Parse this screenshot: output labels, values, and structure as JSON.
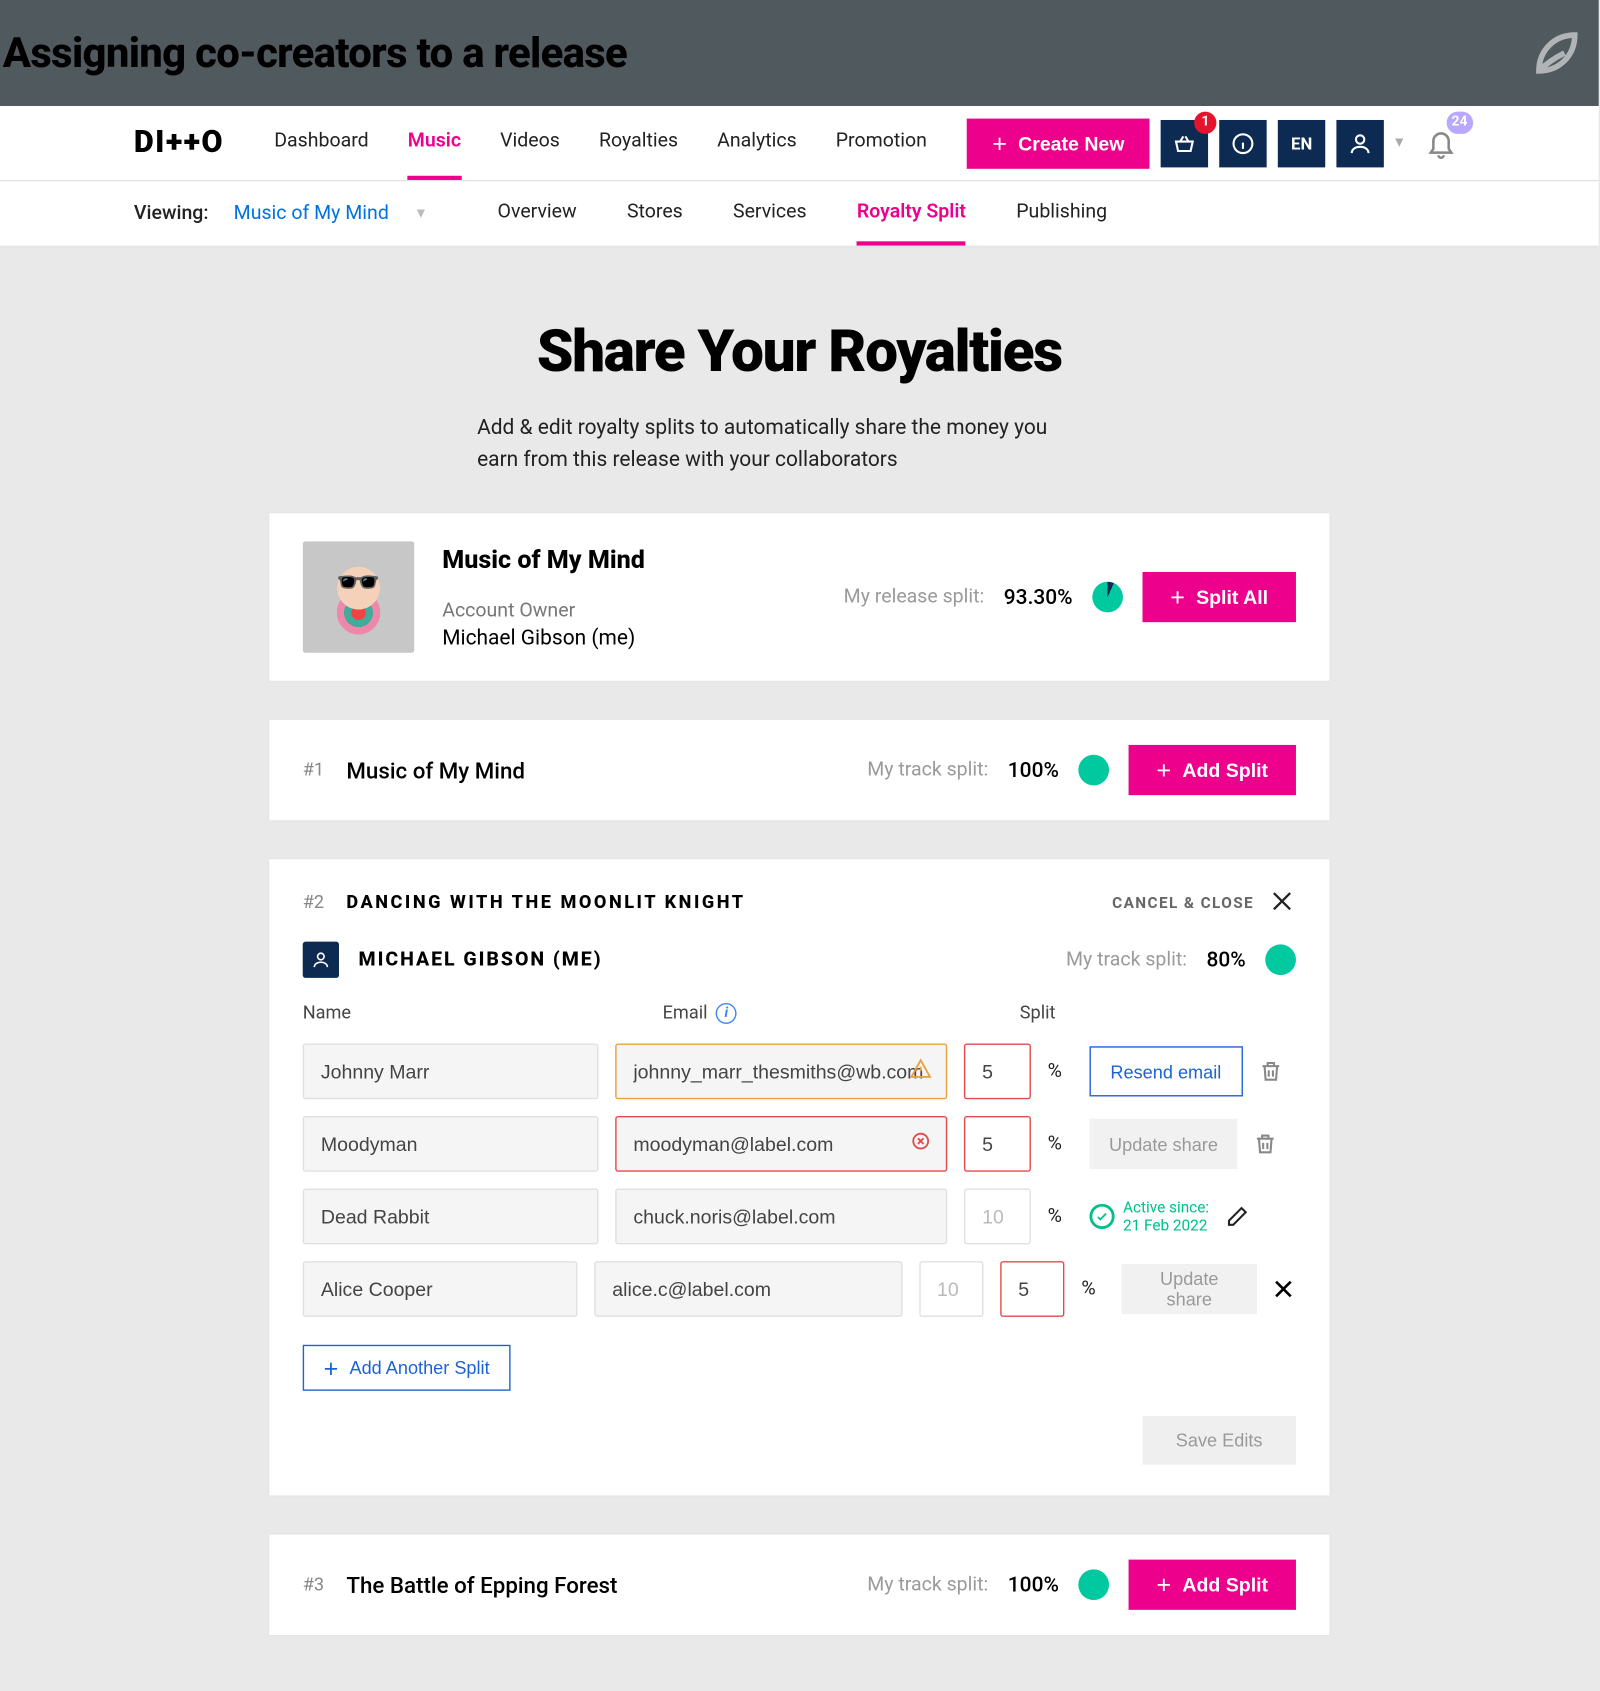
{
  "page_header": {
    "title": "Assigning co-creators to a release"
  },
  "logo": "DI++O",
  "nav": {
    "items": [
      "Dashboard",
      "Music",
      "Videos",
      "Royalties",
      "Analytics",
      "Promotion"
    ],
    "active": "Music",
    "create_label": "Create New",
    "cart_badge": "1",
    "lang": "EN",
    "bell_badge": "24"
  },
  "subnav": {
    "viewing_label": "Viewing:",
    "release": "Music of My Mind",
    "items": [
      "Overview",
      "Stores",
      "Services",
      "Royalty Split",
      "Publishing"
    ],
    "active": "Royalty Split"
  },
  "hero": {
    "title": "Share Your Royalties",
    "sub": "Add & edit royalty splits to automatically share the money you earn from this release with your collaborators"
  },
  "release_card": {
    "title": "Music of My Mind",
    "role": "Account Owner",
    "owner": "Michael Gibson (me)",
    "split_label": "My release split:",
    "split_pct": "93.30%",
    "button": "Split All"
  },
  "tracks": [
    {
      "num": "#1",
      "title": "Music of My Mind",
      "split_label": "My track split:",
      "split_pct": "100%",
      "button": "Add Split"
    },
    {
      "num": "#2",
      "title": "DANCING WITH THE MOONLIT KNIGHT",
      "cancel_label": "CANCEL & CLOSE",
      "me_name": "MICHAEL GIBSON (ME)",
      "my_split_label": "My track split:",
      "my_split_pct": "80%",
      "col_name": "Name",
      "col_email": "Email",
      "col_split": "Split",
      "rows": [
        {
          "name": "Johnny Marr",
          "email": "johnny_marr_thesmiths@wb.com",
          "split": "5",
          "email_state": "warn",
          "action": {
            "type": "resend",
            "label": "Resend email"
          },
          "tail": "trash"
        },
        {
          "name": "Moodyman",
          "email": "moodyman@label.com",
          "split": "5",
          "email_state": "err",
          "action": {
            "type": "update",
            "label": "Update share"
          },
          "tail": "trash"
        },
        {
          "name": "Dead Rabbit",
          "email": "chuck.noris@label.com",
          "split_ghost": "10",
          "action": {
            "type": "active",
            "label": "Active since:",
            "date": "21 Feb 2022"
          },
          "tail": "edit"
        },
        {
          "name": "Alice Cooper",
          "email": "alice.c@label.com",
          "split_ghost": "10",
          "split": "5",
          "action": {
            "type": "update",
            "label": "Update share"
          },
          "tail": "x"
        }
      ],
      "add_another": "Add Another Split",
      "save": "Save Edits"
    },
    {
      "num": "#3",
      "title": "The Battle of Epping Forest",
      "split_label": "My track split:",
      "split_pct": "100%",
      "button": "Add Split"
    }
  ]
}
